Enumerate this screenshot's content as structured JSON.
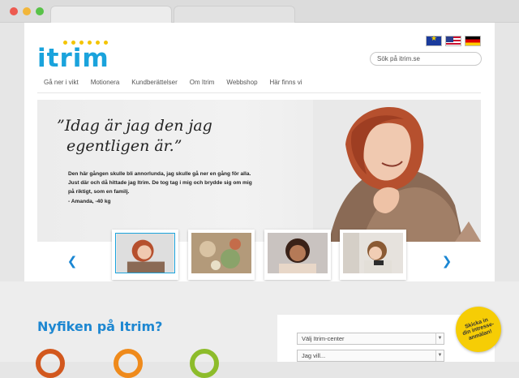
{
  "browser": {
    "tabs": [
      "",
      ""
    ]
  },
  "brand": {
    "logo_text": "itrim",
    "accent": "#1aa3dc",
    "dot_color": "#f4c400"
  },
  "header": {
    "flags": [
      "eu-flag-icon",
      "us-flag-icon",
      "de-flag-icon"
    ],
    "search_placeholder": "Sök på itrim.se"
  },
  "nav": {
    "items": [
      {
        "label": "Gå ner i vikt"
      },
      {
        "label": "Motionera"
      },
      {
        "label": "Kundberättelser"
      },
      {
        "label": "Om Itrim"
      },
      {
        "label": "Webbshop"
      },
      {
        "label": "Här finns vi"
      }
    ]
  },
  "hero": {
    "quote_line1": "”Idag är jag den jag",
    "quote_line2": "egentligen är.”",
    "story": "Den här gången skulle bli annorlunda, jag skulle gå ner en gång för alla. Just där och då hittade jag Itrim. De tog tag i mig och brydde sig om mig på riktigt, som en familj.",
    "signature": "- Amanda, -40 kg"
  },
  "carousel": {
    "prev_icon": "chevron-left-icon",
    "next_icon": "chevron-right-icon",
    "thumbnails": [
      "woman-laughing",
      "food-plate",
      "woman-smiling",
      "woman-with-pony-tail"
    ]
  },
  "lower": {
    "heading": "Nyfiken på Itrim?",
    "select_center": "Välj Itrim-center",
    "select_want": "Jag vill...",
    "badge_lines": [
      "Skicka in",
      "din intresse-",
      "anmälan!"
    ]
  }
}
